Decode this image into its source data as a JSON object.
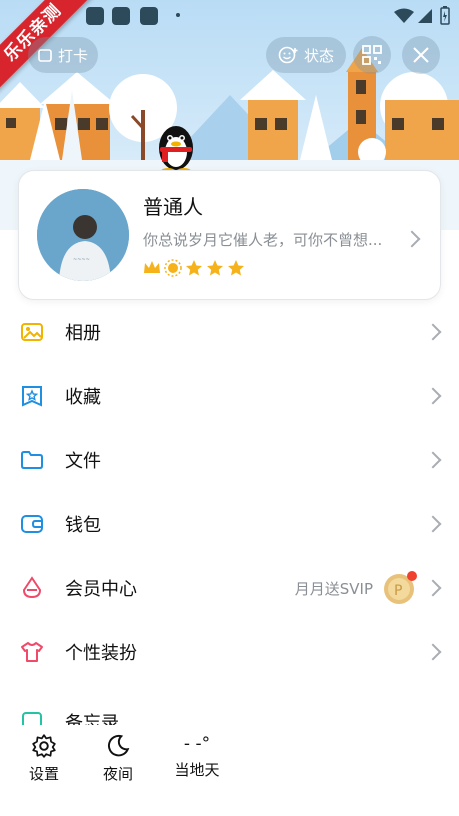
{
  "watermark": "乐乐亲测",
  "header": {
    "clockin_label": "打卡",
    "status_label": "状态"
  },
  "profile": {
    "name": "普通人",
    "signature": "你总说岁月它催人老，可你不曾想..."
  },
  "menu": [
    {
      "label": "相册",
      "icon": "photo-album-icon",
      "color": "#f2b200"
    },
    {
      "label": "收藏",
      "icon": "favorites-icon",
      "color": "#1e8fe1"
    },
    {
      "label": "文件",
      "icon": "folder-icon",
      "color": "#1e8fe1"
    },
    {
      "label": "钱包",
      "icon": "wallet-icon",
      "color": "#1e8fe1"
    },
    {
      "label": "会员中心",
      "icon": "vip-icon",
      "color": "#f04a6a",
      "promo": "月月送SVIP"
    },
    {
      "label": "个性装扮",
      "icon": "tshirt-icon",
      "color": "#f04a6a"
    },
    {
      "label": "备忘录",
      "icon": "memo-icon",
      "color": "#24c3a1"
    }
  ],
  "bottom": {
    "settings_label": "设置",
    "night_label": "夜间",
    "weather_temp": "- -°",
    "weather_label": "当地天"
  }
}
